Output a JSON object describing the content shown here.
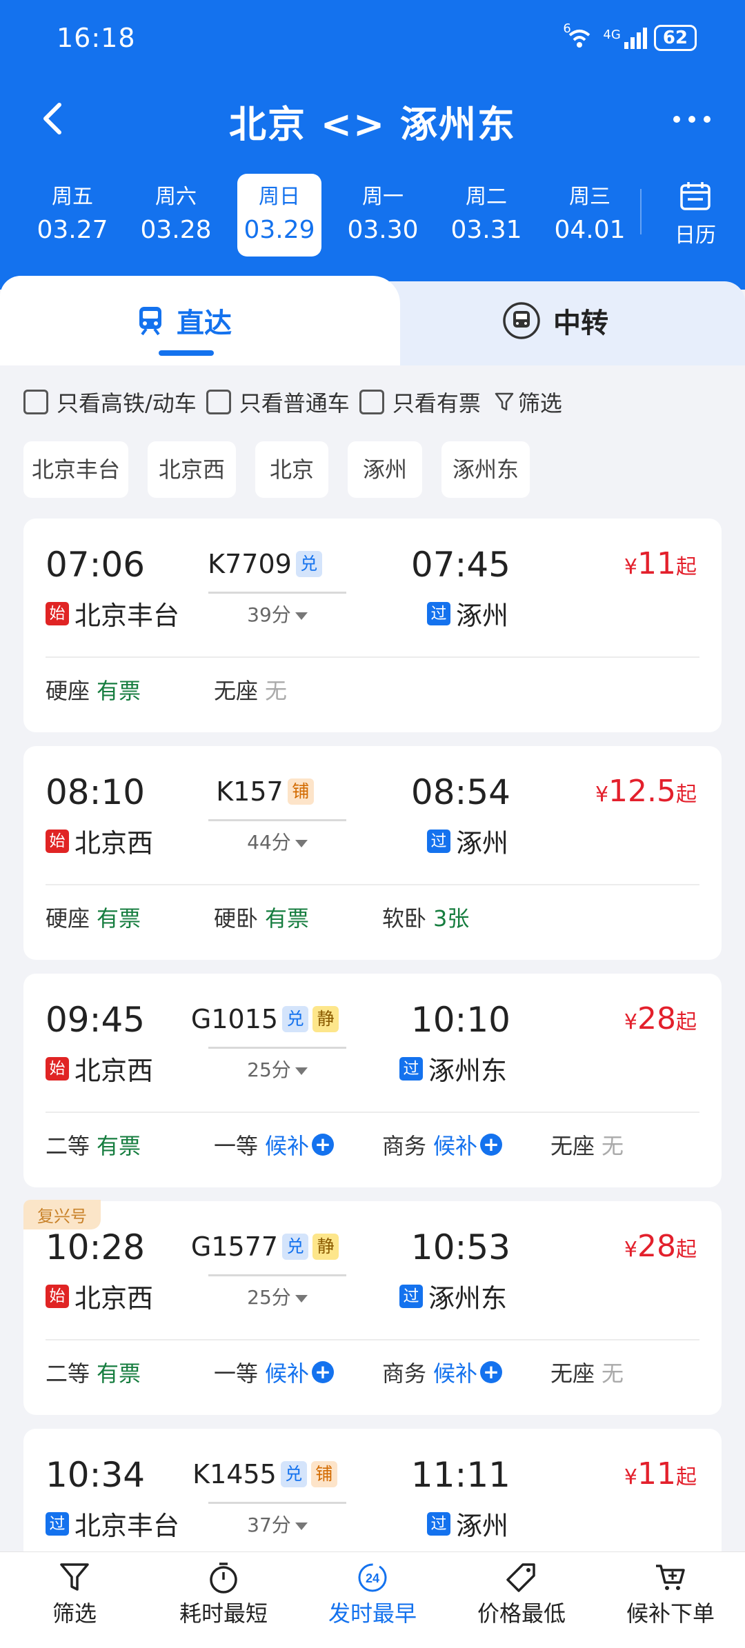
{
  "status": {
    "time": "16:18",
    "network": "4G",
    "wifi_badge": "6",
    "battery": "62"
  },
  "header": {
    "title": "北京 <> 涿州东"
  },
  "dates": [
    {
      "weekday": "周五",
      "date": "03.27"
    },
    {
      "weekday": "周六",
      "date": "03.28"
    },
    {
      "weekday": "周日",
      "date": "03.29"
    },
    {
      "weekday": "周一",
      "date": "03.30"
    },
    {
      "weekday": "周二",
      "date": "03.31"
    },
    {
      "weekday": "周三",
      "date": "04.01"
    }
  ],
  "calendar_label": "日历",
  "tabs": {
    "direct": "直达",
    "transfer": "中转"
  },
  "filters": {
    "high_speed": "只看高铁/动车",
    "normal": "只看普通车",
    "available": "只看有票",
    "screen": "筛选"
  },
  "stations": [
    "北京丰台",
    "北京西",
    "北京",
    "涿州",
    "涿州东"
  ],
  "trains": [
    {
      "dep_time": "07:06",
      "arr_time": "07:45",
      "train_no": "K7709",
      "tags": [
        "兑"
      ],
      "dep_badge": "始",
      "dep_station": "北京丰台",
      "arr_badge": "过",
      "arr_station": "涿州",
      "duration": "39分",
      "price_symbol": "¥",
      "price": "11",
      "price_suffix": "起",
      "seats": [
        {
          "name": "硬座",
          "status": "有票"
        },
        {
          "name": "无座",
          "status": "无"
        }
      ]
    },
    {
      "dep_time": "08:10",
      "arr_time": "08:54",
      "train_no": "K157",
      "tags": [
        "铺"
      ],
      "dep_badge": "始",
      "dep_station": "北京西",
      "arr_badge": "过",
      "arr_station": "涿州",
      "duration": "44分",
      "price_symbol": "¥",
      "price": "12.5",
      "price_suffix": "起",
      "seats": [
        {
          "name": "硬座",
          "status": "有票"
        },
        {
          "name": "硬卧",
          "status": "有票"
        },
        {
          "name": "软卧",
          "status": "3张"
        }
      ]
    },
    {
      "dep_time": "09:45",
      "arr_time": "10:10",
      "train_no": "G1015",
      "tags": [
        "兑",
        "静"
      ],
      "dep_badge": "始",
      "dep_station": "北京西",
      "arr_badge": "过",
      "arr_station": "涿州东",
      "duration": "25分",
      "price_symbol": "¥",
      "price": "28",
      "price_suffix": "起",
      "seats": [
        {
          "name": "二等",
          "status": "有票"
        },
        {
          "name": "一等",
          "status": "候补"
        },
        {
          "name": "商务",
          "status": "候补"
        },
        {
          "name": "无座",
          "status": "无"
        }
      ]
    },
    {
      "badge": "复兴号",
      "dep_time": "10:28",
      "arr_time": "10:53",
      "train_no": "G1577",
      "tags": [
        "兑",
        "静"
      ],
      "dep_badge": "始",
      "dep_station": "北京西",
      "arr_badge": "过",
      "arr_station": "涿州东",
      "duration": "25分",
      "price_symbol": "¥",
      "price": "28",
      "price_suffix": "起",
      "seats": [
        {
          "name": "二等",
          "status": "有票"
        },
        {
          "name": "一等",
          "status": "候补"
        },
        {
          "name": "商务",
          "status": "候补"
        },
        {
          "name": "无座",
          "status": "无"
        }
      ]
    },
    {
      "dep_time": "10:34",
      "arr_time": "11:11",
      "train_no": "K1455",
      "tags": [
        "兑",
        "铺"
      ],
      "dep_badge": "过",
      "dep_station": "北京丰台",
      "arr_badge": "过",
      "arr_station": "涿州",
      "duration": "37分",
      "price_symbol": "¥",
      "price": "11",
      "price_suffix": "起",
      "seats": []
    }
  ],
  "bottom_nav": [
    {
      "label": "筛选",
      "icon": "filter-icon"
    },
    {
      "label": "耗时最短",
      "icon": "stopwatch-icon"
    },
    {
      "label": "发时最早",
      "icon": "clock-24-icon",
      "icon_text": "24"
    },
    {
      "label": "价格最低",
      "icon": "price-tag-icon"
    },
    {
      "label": "候补下单",
      "icon": "cart-icon"
    }
  ],
  "colors": {
    "brand": "#1472ee",
    "price": "#e3202c",
    "available": "#167d3f",
    "start_badge": "#e02424"
  }
}
